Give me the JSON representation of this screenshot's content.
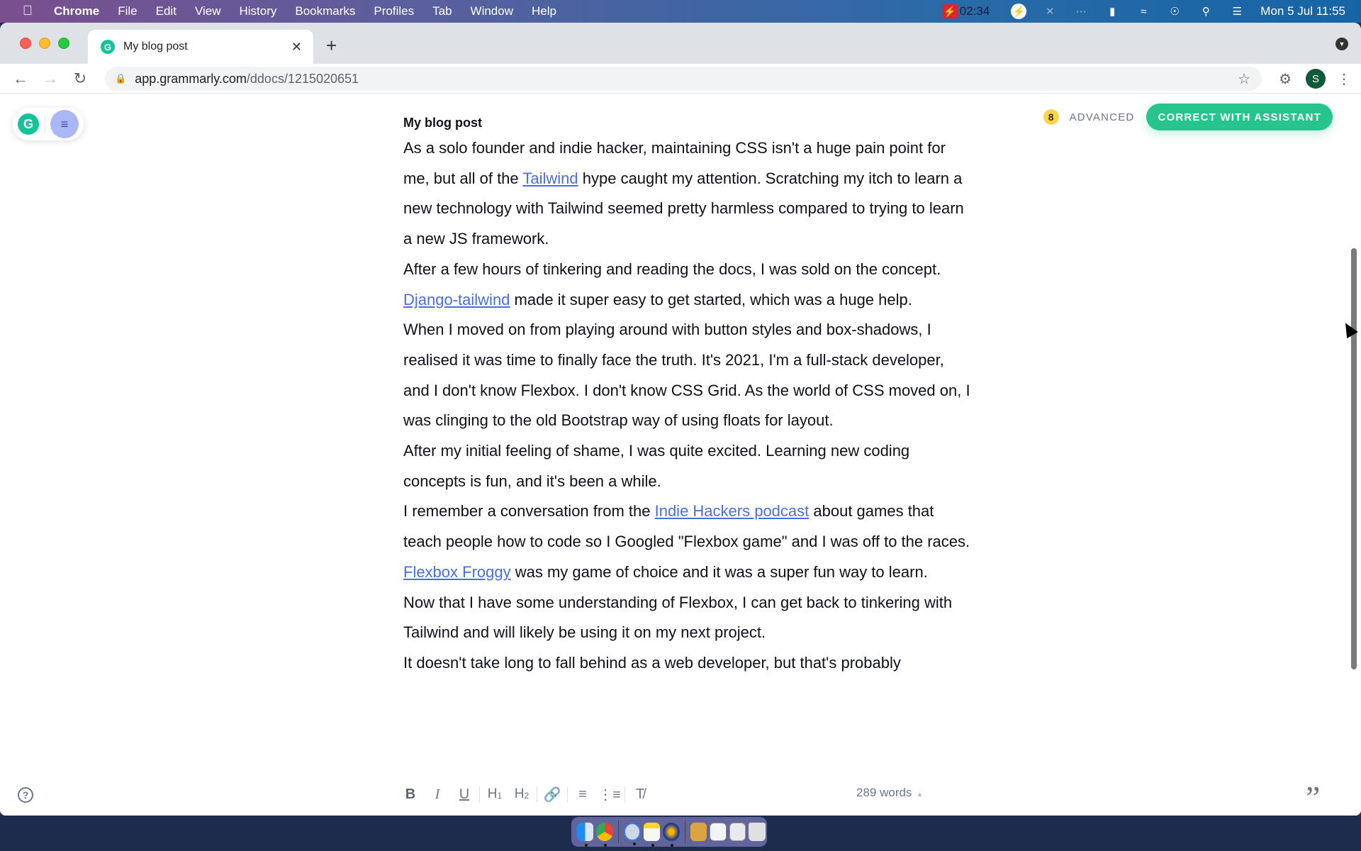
{
  "menubar": {
    "app_name": "Chrome",
    "items": [
      "File",
      "Edit",
      "View",
      "History",
      "Bookmarks",
      "Profiles",
      "Tab",
      "Window",
      "Help"
    ],
    "recording_time": "02:34",
    "datetime": "Mon 5 Jul  11:55",
    "status_icons": [
      "recording-icon",
      "bolt-icon",
      "bluetooth-off-icon",
      "brightness-icon",
      "battery-charging-icon",
      "wifi-icon",
      "user-icon",
      "spotlight-search-icon",
      "control-center-icon"
    ]
  },
  "browser": {
    "tab_title": "My blog post",
    "url_host": "app.grammarly.com",
    "url_path": "/ddocs/1215020651",
    "profile_initial": "S"
  },
  "grammarly": {
    "doc_title": "My blog post",
    "alert_count": "8",
    "mode_label": "ADVANCED",
    "correct_button": "CORRECT WITH ASSISTANT",
    "word_count": "289 words",
    "links_color": "#4a6ee0",
    "accent_color": "#27c48d",
    "paragraphs": [
      {
        "segments": [
          {
            "text": "As a solo founder and indie hacker, maintaining CSS isn't a huge pain point for me, but all of the "
          },
          {
            "text": "Tailwind",
            "link": true
          },
          {
            "text": " hype caught my attention. Scratching my itch to learn a new technology with Tailwind seemed pretty harmless compared to trying to learn a new JS framework."
          }
        ]
      },
      {
        "segments": [
          {
            "text": "After a few hours of tinkering and reading the docs, I was sold on the concept. "
          },
          {
            "text": "Django-tailwind",
            "link": true
          },
          {
            "text": " made it super easy to get started, which was a huge help."
          }
        ]
      },
      {
        "segments": [
          {
            "text": "When I moved on from playing around with button styles and box-shadows, I realised it was time to finally face the truth. It's 2021, I'm a full-stack developer, and I don't know Flexbox. I don't know CSS Grid. As the world of CSS moved on, I was clinging to the old Bootstrap way of using floats for layout."
          }
        ]
      },
      {
        "segments": [
          {
            "text": "After my initial feeling of shame, I was quite excited. Learning new coding concepts is fun, and it's been a while."
          }
        ]
      },
      {
        "segments": [
          {
            "text": "I remember a conversation from the "
          },
          {
            "text": "Indie Hackers podcast",
            "link": true
          },
          {
            "text": " about games that teach people how to code so I Googled \"Flexbox game\" and I was off to the races. "
          },
          {
            "text": "Flexbox Froggy",
            "link": true
          },
          {
            "text": " was my game of choice and it was a super fun way to learn."
          }
        ]
      },
      {
        "segments": [
          {
            "text": "Now that I have some understanding of Flexbox, I can get back to tinkering with Tailwind and will likely be using it on my next project."
          }
        ]
      },
      {
        "segments": [
          {
            "text": "It doesn't take long to fall behind as a web developer, but that's probably"
          }
        ]
      }
    ],
    "format_toolbar": {
      "bold": "B",
      "italic": "I",
      "underline": "U",
      "h1": "H",
      "h2": "H",
      "h1_sub": "1",
      "h2_sub": "2"
    }
  },
  "dock": {
    "apps": [
      "Finder",
      "Chrome",
      "1Password",
      "Notes",
      "Reeder",
      "Package",
      "Window preview",
      "Window preview",
      "Trash"
    ]
  }
}
